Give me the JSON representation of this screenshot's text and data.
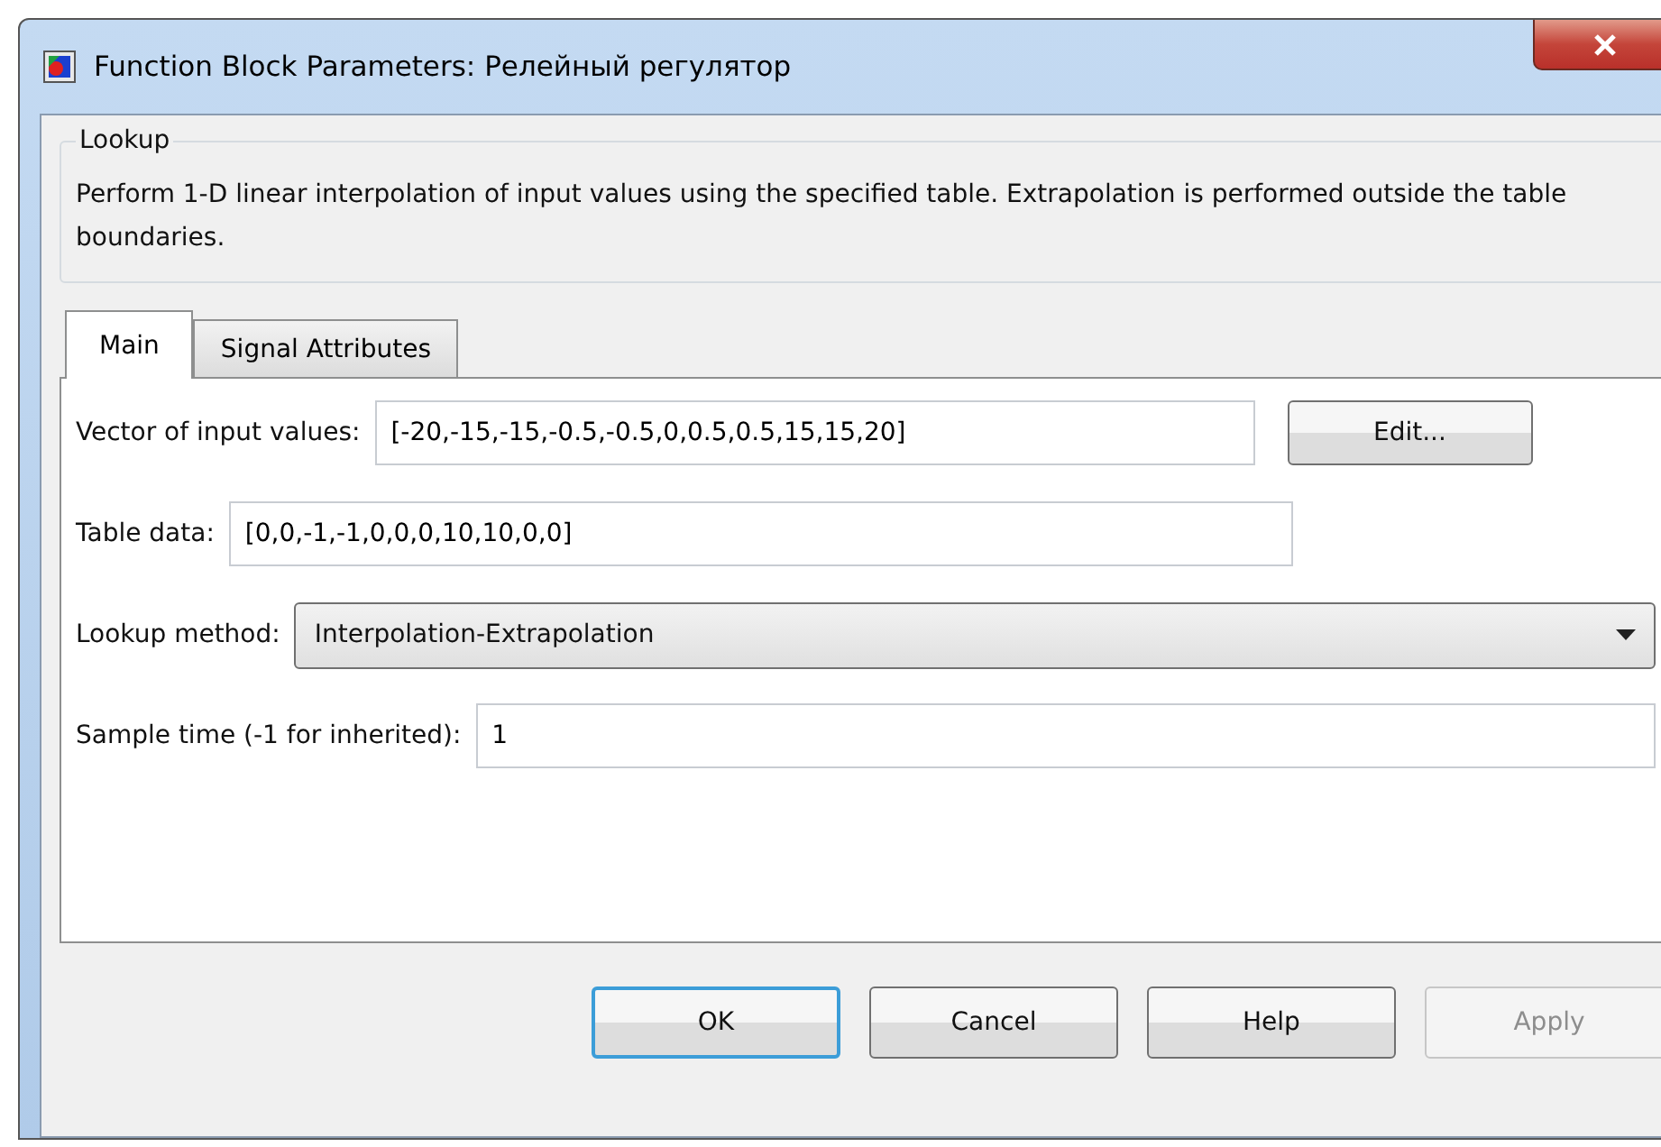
{
  "window": {
    "title": "Function Block Parameters: Релейный регулятор"
  },
  "group": {
    "title": "Lookup",
    "description": "Perform 1-D linear interpolation of input values using the specified table.  Extrapolation is performed outside the table boundaries."
  },
  "tabs": [
    {
      "label": "Main",
      "selected": true
    },
    {
      "label": "Signal Attributes",
      "selected": false
    }
  ],
  "fields": [
    {
      "kind": "text",
      "label": "Vector of input values:",
      "value": "[-20,-15,-15,-0.5,-0.5,0,0.5,0.5,15,15,20]",
      "button": "Edit..."
    },
    {
      "kind": "text",
      "label": "Table data:",
      "value": "[0,0,-1,-1,0,0,0,10,10,0,0]"
    },
    {
      "kind": "dropdown",
      "label": "Lookup method:",
      "value": "Interpolation-Extrapolation"
    },
    {
      "kind": "text",
      "label": "Sample time (-1 for inherited):",
      "value": "1"
    }
  ],
  "buttons": [
    {
      "label": "OK",
      "default": true,
      "disabled": false
    },
    {
      "label": "Cancel",
      "default": false,
      "disabled": false
    },
    {
      "label": "Help",
      "default": false,
      "disabled": false
    },
    {
      "label": "Apply",
      "default": false,
      "disabled": true
    }
  ]
}
